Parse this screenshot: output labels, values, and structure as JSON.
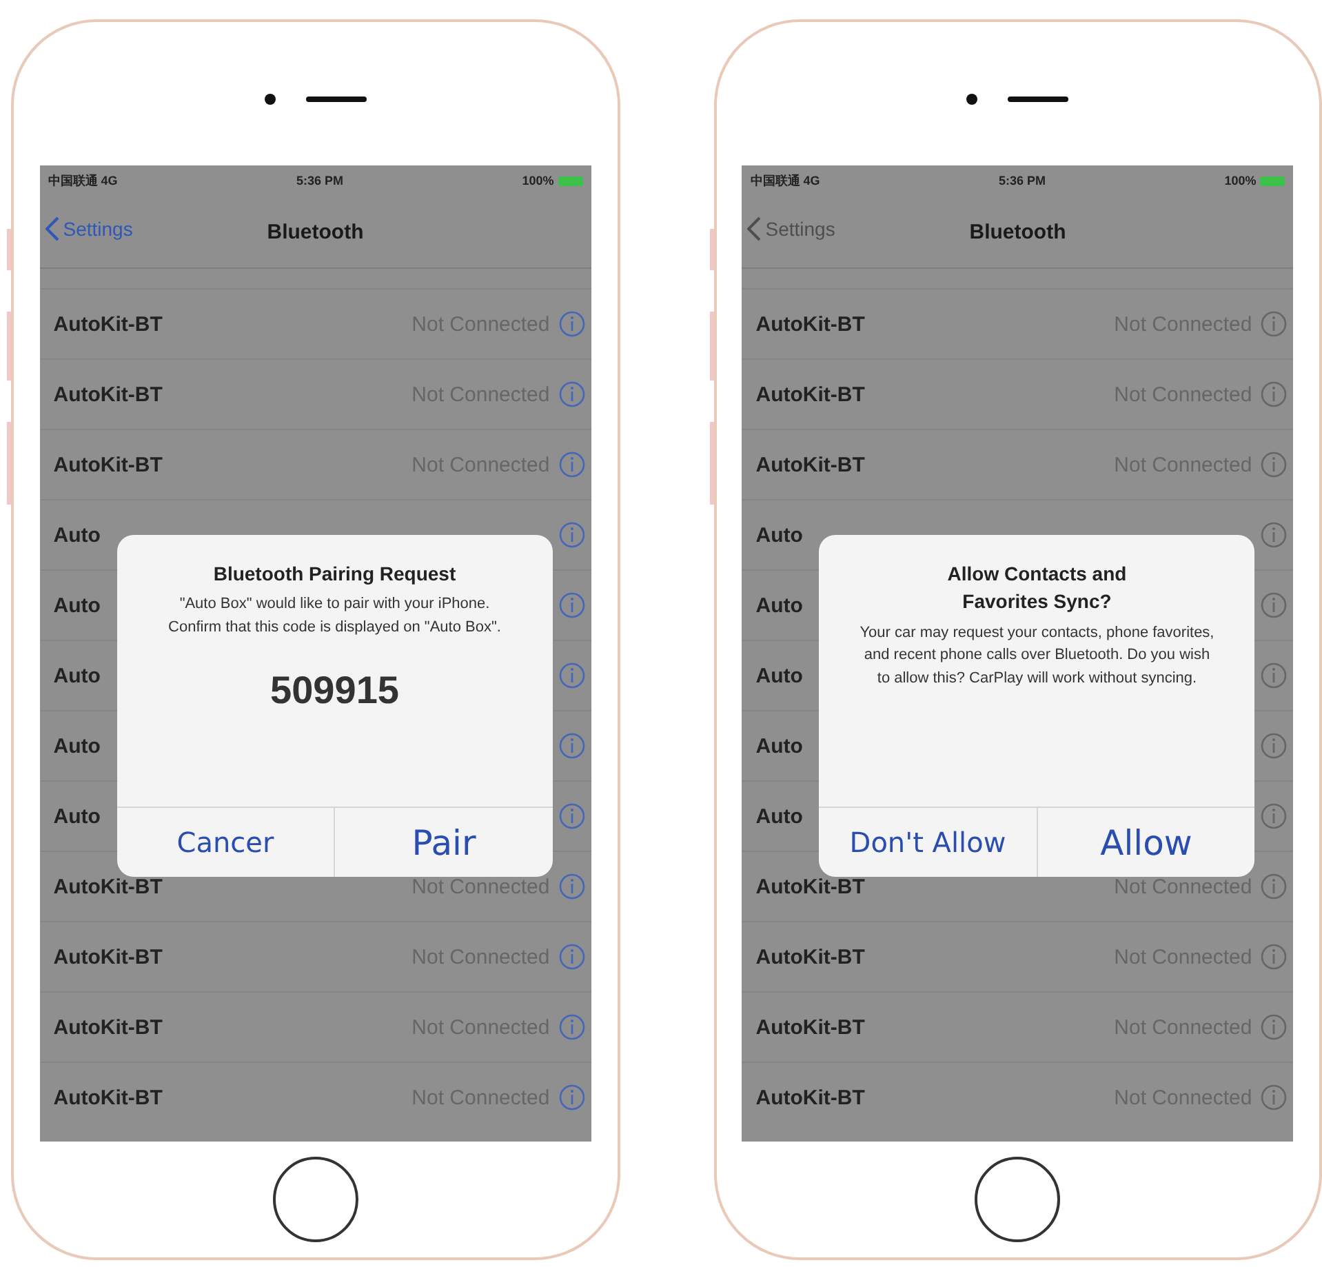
{
  "phones": [
    {
      "status_bar": {
        "carrier": "中国联通 4G",
        "time": "5:36 PM",
        "battery": "100%"
      },
      "nav": {
        "back": "Settings",
        "back_dimmed": false,
        "title": "Bluetooth"
      },
      "devices": [
        {
          "name": "AutoKit-BT",
          "status": "Not Connected"
        },
        {
          "name": "AutoKit-BT",
          "status": "Not Connected"
        },
        {
          "name": "AutoKit-BT",
          "status": "Not Connected"
        },
        {
          "name": "Auto"
        },
        {
          "name": "Auto"
        },
        {
          "name": "Auto"
        },
        {
          "name": "Auto"
        },
        {
          "name": "Auto"
        },
        {
          "name": "AutoKit-BT",
          "status": "Not Connected"
        },
        {
          "name": "AutoKit-BT",
          "status": "Not Connected"
        },
        {
          "name": "AutoKit-BT",
          "status": "Not Connected"
        },
        {
          "name": "AutoKit-BT",
          "status": "Not Connected"
        }
      ],
      "alert": {
        "title": "Bluetooth Pairing Request",
        "message": "\"Auto Box\" would like to pair with your iPhone. Confirm that this code is displayed on \"Auto Box\".",
        "code": "509915",
        "buttons": [
          {
            "label": "Cancer",
            "kind": "plain"
          },
          {
            "label": "Pair",
            "kind": "large"
          }
        ]
      }
    },
    {
      "status_bar": {
        "carrier": "中国联通 4G",
        "time": "5:36 PM",
        "battery": "100%"
      },
      "nav": {
        "back": "Settings",
        "back_dimmed": true,
        "title": "Bluetooth"
      },
      "devices": [
        {
          "name": "AutoKit-BT",
          "status": "Not Connected"
        },
        {
          "name": "AutoKit-BT",
          "status": "Not Connected"
        },
        {
          "name": "AutoKit-BT",
          "status": "Not Connected"
        },
        {
          "name": "Auto"
        },
        {
          "name": "Auto"
        },
        {
          "name": "Auto"
        },
        {
          "name": "Auto"
        },
        {
          "name": "Auto"
        },
        {
          "name": "AutoKit-BT",
          "status": "Not Connected"
        },
        {
          "name": "AutoKit-BT",
          "status": "Not Connected"
        },
        {
          "name": "AutoKit-BT",
          "status": "Not Connected"
        },
        {
          "name": "AutoKit-BT",
          "status": "Not Connected"
        }
      ],
      "alert": {
        "title": "Allow Contacts and Favorites Sync?",
        "message": "Your car may request your contacts, phone favorites, and recent phone calls over Bluetooth. Do you wish to allow this? CarPlay will work without syncing.",
        "buttons": [
          {
            "label": "Don't Allow",
            "kind": "plain"
          },
          {
            "label": "Allow",
            "kind": "large"
          }
        ]
      }
    }
  ]
}
